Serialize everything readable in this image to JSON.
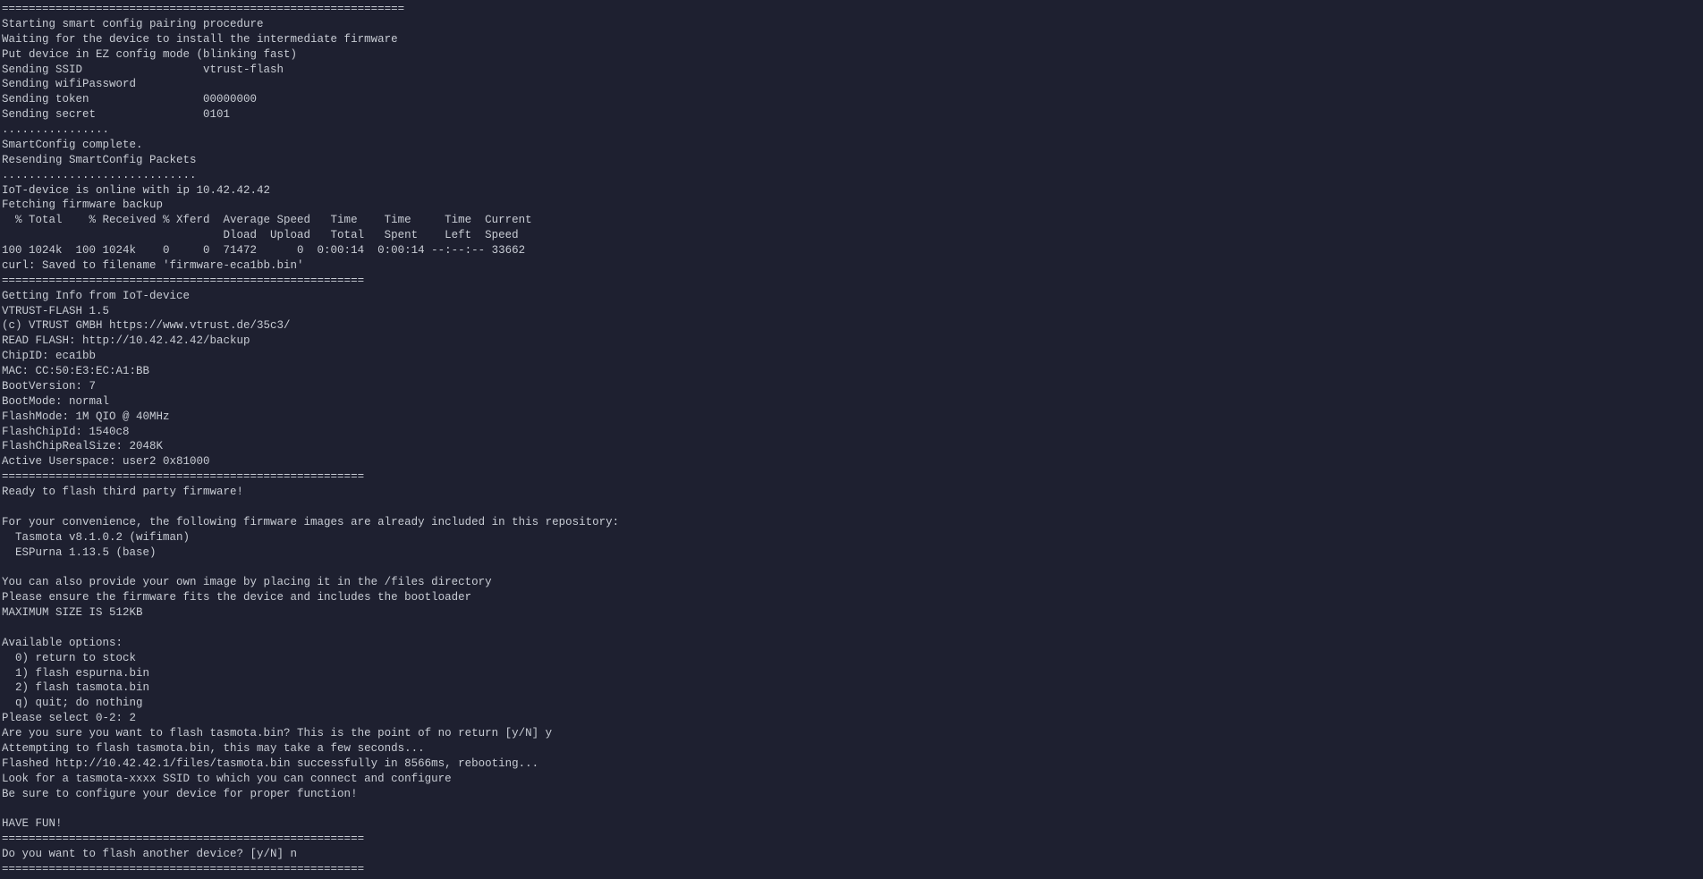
{
  "terminal": {
    "lines": [
      "============================================================",
      "Starting smart config pairing procedure",
      "Waiting for the device to install the intermediate firmware",
      "Put device in EZ config mode (blinking fast)",
      "Sending SSID                  vtrust-flash",
      "Sending wifiPassword          ",
      "Sending token                 00000000",
      "Sending secret                0101",
      "................",
      "SmartConfig complete.",
      "Resending SmartConfig Packets",
      ".............................",
      "IoT-device is online with ip 10.42.42.42",
      "Fetching firmware backup",
      "  % Total    % Received % Xferd  Average Speed   Time    Time     Time  Current",
      "                                 Dload  Upload   Total   Spent    Left  Speed",
      "100 1024k  100 1024k    0     0  71472      0  0:00:14  0:00:14 --:--:-- 33662",
      "curl: Saved to filename 'firmware-eca1bb.bin'",
      "======================================================",
      "Getting Info from IoT-device",
      "VTRUST-FLASH 1.5",
      "(c) VTRUST GMBH https://www.vtrust.de/35c3/",
      "READ FLASH: http://10.42.42.42/backup",
      "ChipID: eca1bb",
      "MAC: CC:50:E3:EC:A1:BB",
      "BootVersion: 7",
      "BootMode: normal",
      "FlashMode: 1M QIO @ 40MHz",
      "FlashChipId: 1540c8",
      "FlashChipRealSize: 2048K",
      "Active Userspace: user2 0x81000",
      "======================================================",
      "Ready to flash third party firmware!",
      "",
      "For your convenience, the following firmware images are already included in this repository:",
      "  Tasmota v8.1.0.2 (wifiman)",
      "  ESPurna 1.13.5 (base)",
      "",
      "You can also provide your own image by placing it in the /files directory",
      "Please ensure the firmware fits the device and includes the bootloader",
      "MAXIMUM SIZE IS 512KB",
      "",
      "Available options:",
      "  0) return to stock",
      "  1) flash espurna.bin",
      "  2) flash tasmota.bin",
      "  q) quit; do nothing",
      "Please select 0-2: 2",
      "Are you sure you want to flash tasmota.bin? This is the point of no return [y/N] y",
      "Attempting to flash tasmota.bin, this may take a few seconds...",
      "Flashed http://10.42.42.1/files/tasmota.bin successfully in 8566ms, rebooting...",
      "Look for a tasmota-xxxx SSID to which you can connect and configure",
      "Be sure to configure your device for proper function!",
      "",
      "HAVE FUN!",
      "======================================================",
      "Do you want to flash another device? [y/N] n",
      "======================================================"
    ]
  }
}
